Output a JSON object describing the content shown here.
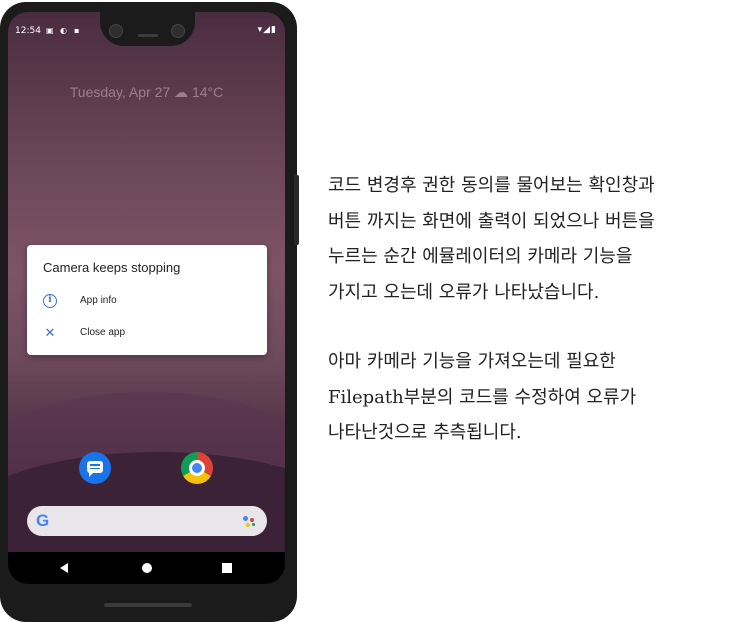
{
  "status_bar": {
    "time": "12:54",
    "left_icons": [
      "notification-icon",
      "settings-icon",
      "sd-card-icon"
    ],
    "right_icons": "▾◢▮"
  },
  "at_a_glance": "Tuesday, Apr 27 ☁ 14°C",
  "dialog": {
    "title": "Camera keeps stopping",
    "items": [
      {
        "icon": "info-icon",
        "label": "App info"
      },
      {
        "icon": "close-icon",
        "label": "Close app"
      }
    ]
  },
  "dock": [
    "messages-icon",
    "chrome-icon"
  ],
  "search": {
    "logo": "G"
  },
  "nav": [
    "back-button",
    "home-button",
    "recents-button"
  ],
  "explanation": {
    "paragraph1": [
      "코드 변경후 권한 동의를 물어보는 확인창과",
      "버튼 까지는 화면에 출력이 되었으나 버튼을",
      "누르는 순간 에뮬레이터의 카메라 기능을",
      "가지고 오는데 오류가 나타났습니다."
    ],
    "paragraph2": [
      "아마 카메라 기능을 가져오는데 필요한",
      "Filepath부분의 코드를 수정하여 오류가",
      "나타난것으로 추측됩니다."
    ]
  },
  "colors": {
    "accent": "#3f6fe0",
    "wallpaper": "#6a4558"
  }
}
